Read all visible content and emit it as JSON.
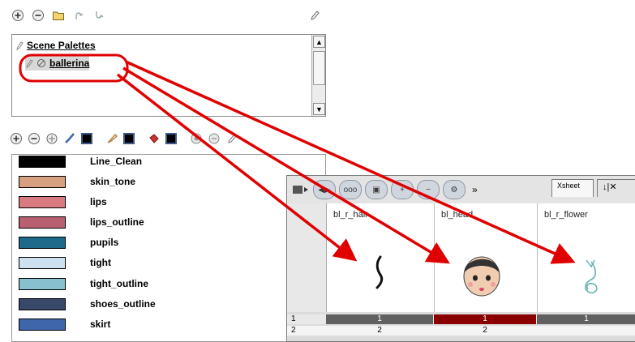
{
  "palette_panel": {
    "header": "Scene Palettes",
    "selected": "ballerina"
  },
  "colors": [
    {
      "name": "Line_Clean",
      "hex": "#000000"
    },
    {
      "name": "skin_tone",
      "hex": "#d6a080"
    },
    {
      "name": "lips",
      "hex": "#d87a80"
    },
    {
      "name": "lips_outline",
      "hex": "#b86070"
    },
    {
      "name": "pupils",
      "hex": "#1e6a8a"
    },
    {
      "name": "tight",
      "hex": "#cce0f0"
    },
    {
      "name": "tight_outline",
      "hex": "#88c0d0"
    },
    {
      "name": "shoes_outline",
      "hex": "#384868"
    },
    {
      "name": "skirt",
      "hex": "#3e66a8"
    }
  ],
  "xsheet": {
    "tab_label": "Xsheet",
    "more_symbol": "»",
    "columns": [
      {
        "name": "bl_r_hair"
      },
      {
        "name": "bl_head"
      },
      {
        "name": "bl_r_flower"
      }
    ],
    "frames": [
      {
        "number": "1",
        "cells": [
          "1",
          "1",
          "1"
        ]
      },
      {
        "number": "2",
        "cells": [
          "2",
          "2",
          ""
        ]
      }
    ]
  },
  "annotation_color": "#e00000"
}
